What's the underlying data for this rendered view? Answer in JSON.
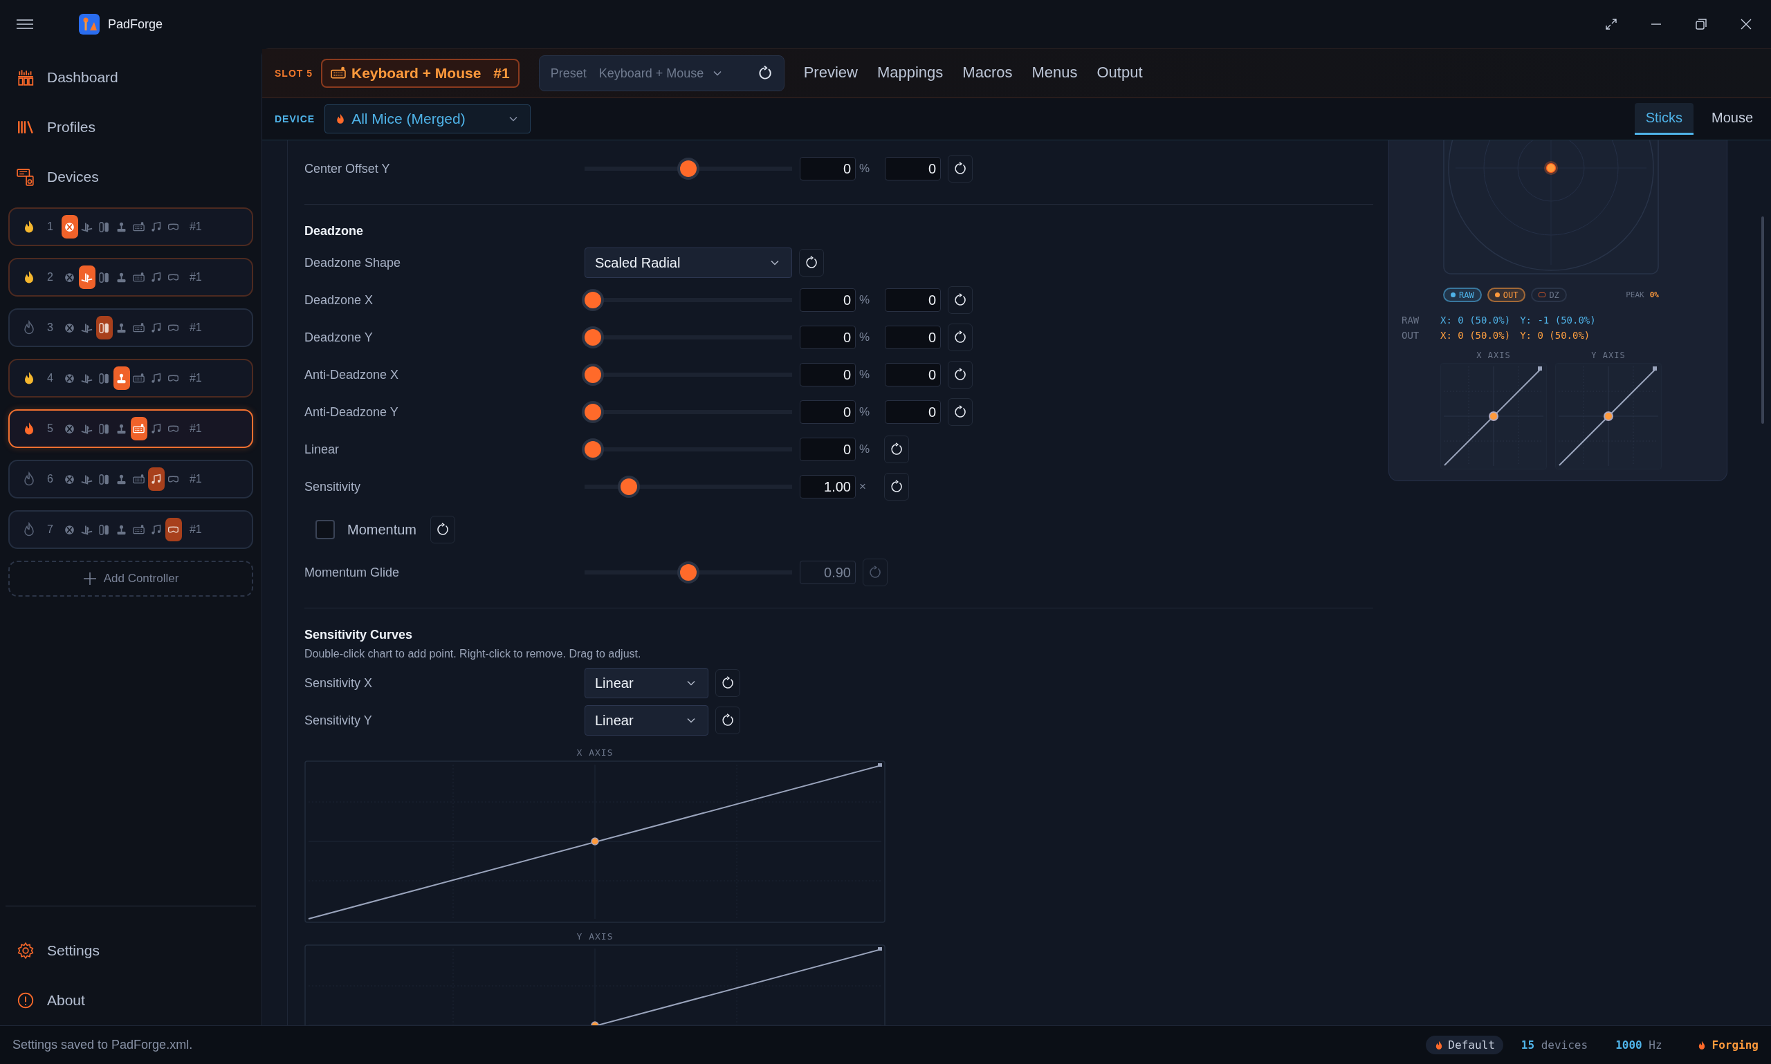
{
  "app": {
    "title": "PadForge"
  },
  "nav": [
    {
      "label": "Dashboard",
      "kind": "dashboard"
    },
    {
      "label": "Profiles",
      "kind": "profiles"
    },
    {
      "label": "Devices",
      "kind": "devices"
    }
  ],
  "controllers": [
    {
      "number": "1",
      "kind": "xbox",
      "connected": true,
      "selected": false,
      "tag": "#1"
    },
    {
      "number": "2",
      "kind": "playstation",
      "connected": true,
      "selected": false,
      "tag": "#1"
    },
    {
      "number": "3",
      "kind": "switch",
      "connected": false,
      "selected": false,
      "tag": "#1"
    },
    {
      "number": "4",
      "kind": "joystick",
      "connected": true,
      "selected": false,
      "tag": "#1"
    },
    {
      "number": "5",
      "kind": "keyboard",
      "connected": true,
      "selected": true,
      "tag": "#1"
    },
    {
      "number": "6",
      "kind": "music",
      "connected": false,
      "selected": false,
      "tag": "#1"
    },
    {
      "number": "7",
      "kind": "vr",
      "connected": false,
      "selected": false,
      "tag": "#1"
    }
  ],
  "add_controller": "Add Controller",
  "footer_nav": [
    {
      "label": "Settings",
      "kind": "settings"
    },
    {
      "label": "About",
      "kind": "about"
    }
  ],
  "toolbar": {
    "slot": "SLOT 5",
    "controller": {
      "name": "Keyboard + Mouse",
      "tag": "#1"
    },
    "preset": {
      "label": "Preset",
      "value": "Keyboard + Mouse"
    },
    "tabs": [
      {
        "label": "Preview",
        "selected": false
      },
      {
        "label": "Mappings",
        "selected": false
      },
      {
        "label": "Macros",
        "selected": false
      },
      {
        "label": "Menus",
        "selected": false
      },
      {
        "label": "Output",
        "selected": false
      }
    ]
  },
  "device": {
    "label": "DEVICE",
    "value": "All Mice (Merged)"
  },
  "subtabs": [
    {
      "label": "Sticks",
      "selected": true
    },
    {
      "label": "Mouse",
      "selected": false
    }
  ],
  "sections": [
    {
      "rows": [
        {
          "kind": "slider",
          "label": "Center Offset Y",
          "level": 0.5,
          "value": "0",
          "unit": "%",
          "value2": "0",
          "disabled": false
        }
      ]
    },
    {
      "title": "Deadzone",
      "rows": [
        {
          "kind": "dropdown",
          "label": "Deadzone Shape",
          "value": "Scaled Radial"
        },
        {
          "kind": "slider",
          "label": "Deadzone X",
          "level": 0,
          "value": "0",
          "unit": "%",
          "value2": "0",
          "disabled": false
        },
        {
          "kind": "slider",
          "label": "Deadzone Y",
          "level": 0,
          "value": "0",
          "unit": "%",
          "value2": "0",
          "disabled": false
        },
        {
          "kind": "slider",
          "label": "Anti-Deadzone X",
          "level": 0,
          "value": "0",
          "unit": "%",
          "value2": "0",
          "disabled": false
        },
        {
          "kind": "slider",
          "label": "Anti-Deadzone Y",
          "level": 0,
          "value": "0",
          "unit": "%",
          "value2": "0",
          "disabled": false
        },
        {
          "kind": "slider",
          "label": "Linear",
          "level": 0,
          "value": "0",
          "unit": "%",
          "disabled": false
        },
        {
          "kind": "slider",
          "label": "Sensitivity",
          "level": 0.19,
          "value": "1.00",
          "unit": "×",
          "disabled": false
        },
        {
          "kind": "checkbox",
          "label": "Momentum",
          "checked": false
        },
        {
          "kind": "slider",
          "label": "Momentum Glide",
          "level": 0.5,
          "value": "0.90",
          "disabled": true
        }
      ]
    },
    {
      "title": "Sensitivity Curves",
      "description": "Double-click chart to add point. Right-click to remove. Drag to adjust.",
      "rows": [
        {
          "kind": "dropdown",
          "label": "Sensitivity X",
          "value": "Linear"
        },
        {
          "kind": "dropdown",
          "label": "Sensitivity Y",
          "value": "Linear"
        }
      ],
      "graphs": [
        "X AXIS",
        "Y AXIS"
      ]
    }
  ],
  "preview": {
    "legend": [
      {
        "label": "RAW",
        "kind": "dot",
        "color": "#4fb3e8",
        "on": true
      },
      {
        "label": "OUT",
        "kind": "dot",
        "color": "#ff9a3c",
        "on": true
      },
      {
        "label": "DZ",
        "kind": "square",
        "color": "#c2522a",
        "on": false
      }
    ],
    "peak": {
      "label": "PEAK",
      "value": "0%"
    },
    "readouts": [
      {
        "label": "RAW",
        "x": "X: 0 (50.0%)",
        "y": "Y: -1 (50.0%)",
        "color": "#4fb3e8"
      },
      {
        "label": "OUT",
        "x": "X: 0 (50.0%)",
        "y": "Y: 0 (50.0%)",
        "color": "#ffa040"
      }
    ],
    "axes": [
      "X AXIS",
      "Y AXIS"
    ]
  },
  "status": {
    "message": "Settings saved to PadForge.xml.",
    "profile": "Default",
    "devices_count": "15",
    "devices_label": "devices",
    "rate": "1000",
    "rate_unit": "Hz",
    "state": "Forging"
  }
}
